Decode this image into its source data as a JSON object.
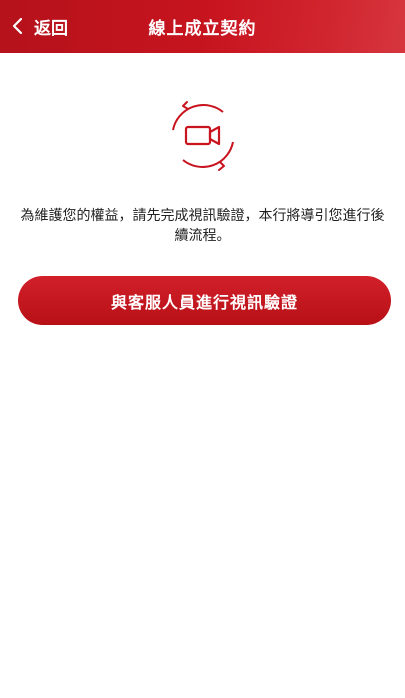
{
  "header": {
    "back_label": "返回",
    "title": "線上成立契約"
  },
  "main": {
    "icon": "video-call-icon",
    "message": "為維護您的權益，請先完成視訊驗證，本行將導引您進行後續流程。",
    "cta_label": "與客服人員進行視訊驗證"
  },
  "colors": {
    "brand_red": "#c8141f",
    "text": "#222222",
    "background": "#ffffff"
  }
}
